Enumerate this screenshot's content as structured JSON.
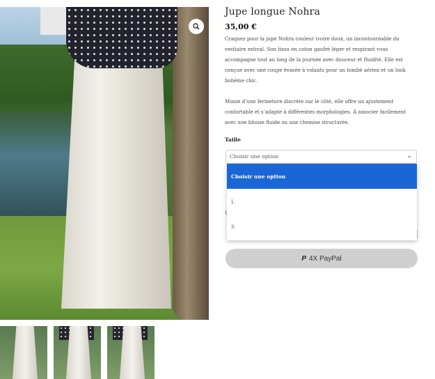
{
  "product": {
    "title": "Jupe longue Nohra",
    "price": "35,00 €",
    "description": [
      "Craquez pour la jupe Nohra couleur ivoire doux, un incontournable du vestiaire estival. Son tissu en coton gaufré léger et respirant vous accompagne tout au long de la journée avec douceur et fluidité. Elle est conçue avec une coupe évasée à volants pour un tombé aérien et un look bohème chic.",
      "Munie d’une fermeture discrète sur le côté, elle offre un ajustement confortable et s’adapte à différentes morphologies. À associer facilement avec une blouse fluide ou une chemise structurée."
    ]
  },
  "variation": {
    "label": "Taille",
    "selected": "Choisir une option",
    "options": [
      "Choisir une option",
      "L",
      "S"
    ],
    "hidden_text": "U"
  },
  "paypal": {
    "icon": "paypal-icon",
    "label": "4X PayPal"
  },
  "gallery": {
    "zoom_icon": "search-icon",
    "thumbnails": 3
  }
}
